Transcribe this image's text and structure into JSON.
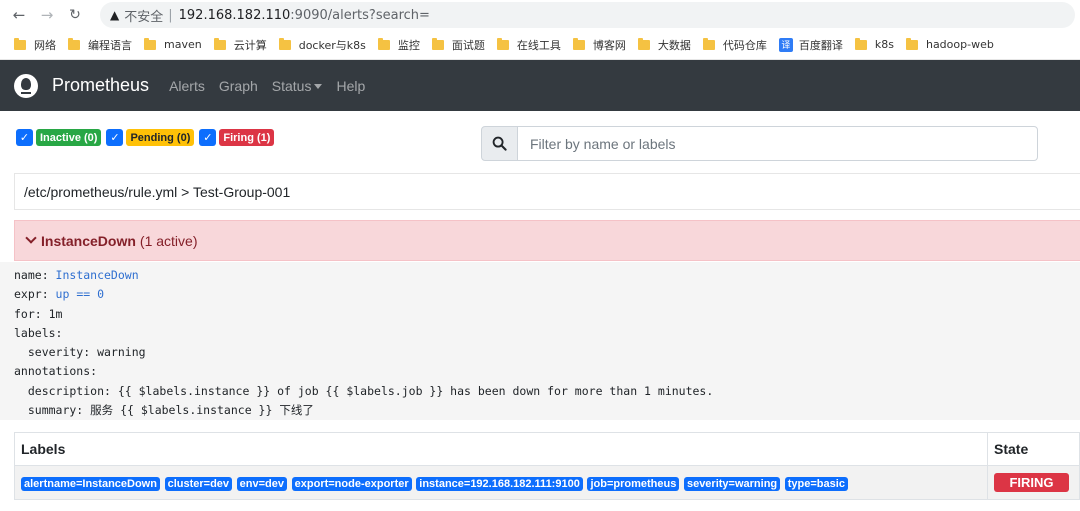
{
  "browser": {
    "insecure_label": "不安全",
    "separator": "|",
    "url_host": "192.168.182.110",
    "url_rest": ":9090/alerts?search="
  },
  "bookmarks": [
    {
      "label": "网络",
      "icon": "folder-icon"
    },
    {
      "label": "编程语言",
      "icon": "folder-icon"
    },
    {
      "label": "maven",
      "icon": "folder-icon"
    },
    {
      "label": "云计算",
      "icon": "folder-icon"
    },
    {
      "label": "docker与k8s",
      "icon": "folder-icon"
    },
    {
      "label": "监控",
      "icon": "folder-icon"
    },
    {
      "label": "面试题",
      "icon": "folder-icon"
    },
    {
      "label": "在线工具",
      "icon": "folder-icon"
    },
    {
      "label": "博客网",
      "icon": "folder-icon"
    },
    {
      "label": "大数据",
      "icon": "folder-icon"
    },
    {
      "label": "代码仓库",
      "icon": "folder-icon"
    },
    {
      "label": "百度翻译",
      "icon": "translate-icon",
      "icon_text": "译"
    },
    {
      "label": "k8s",
      "icon": "folder-icon"
    },
    {
      "label": "hadoop-web",
      "icon": "folder-icon"
    }
  ],
  "navbar": {
    "brand": "Prometheus",
    "links": {
      "alerts": "Alerts",
      "graph": "Graph",
      "status": "Status",
      "help": "Help"
    }
  },
  "filters": {
    "inactive": "Inactive (0)",
    "pending": "Pending (0)",
    "firing": "Firing (1)",
    "check_glyph": "✓"
  },
  "search": {
    "placeholder": "Filter by name or labels"
  },
  "group": {
    "path": "/etc/prometheus/rule.yml > Test-Group-001"
  },
  "alert": {
    "name": "InstanceDown",
    "count": "(1 active)"
  },
  "rule": {
    "name_key": "name: ",
    "name_val": "InstanceDown",
    "expr_key": "expr: ",
    "expr_val": "up == 0",
    "for_line": "for: 1m",
    "labels_line": "labels:",
    "severity_line": "  severity: warning",
    "annotations_line": "annotations:",
    "description_line": "  description: {{ $labels.instance }} of job {{ $labels.job }} has been down for more than 1 minutes.",
    "summary_line": "  summary: 服务 {{ $labels.instance }} 下线了"
  },
  "table": {
    "headers": {
      "labels": "Labels",
      "state": "State"
    },
    "labels": [
      "alertname=InstanceDown",
      "cluster=dev",
      "env=dev",
      "export=node-exporter",
      "instance=192.168.182.111:9100",
      "job=prometheus",
      "severity=warning",
      "type=basic"
    ],
    "state": "FIRING"
  },
  "colors": {
    "navbar_bg": "#343a40",
    "label_blue": "#0d6efd",
    "firing_red": "#dc3545",
    "inactive_green": "#28a745",
    "pending_yellow": "#ffc107",
    "alert_bg": "#f8d7da"
  }
}
